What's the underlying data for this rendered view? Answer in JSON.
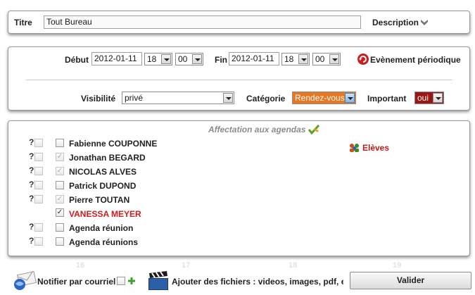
{
  "title_bar": {
    "label": "Titre",
    "value": "Tout Bureau",
    "description_label": "Description"
  },
  "dates": {
    "start_label": "Début",
    "start_date": "2012-01-11",
    "start_hour": "18",
    "start_minute": "00",
    "end_label": "Fin",
    "end_date": "2012-01-11",
    "end_hour": "18",
    "end_minute": "00",
    "recurring_label": "Evènement périodique"
  },
  "options": {
    "visibility_label": "Visibilité",
    "visibility_value": "privé",
    "category_label": "Catégorie",
    "category_value": "Rendez-vous",
    "category_color": "#e87722",
    "important_label": "Important",
    "important_value": "oui",
    "important_color": "#9a1616"
  },
  "agendas": {
    "heading": "Affectation aux agendas",
    "eleves_label": "Elèves",
    "items": [
      {
        "name": "Fabienne COUPONNE",
        "checked": false
      },
      {
        "name": "Jonathan BEGARD",
        "checked": true
      },
      {
        "name": "NICOLAS ALVES",
        "checked": true
      },
      {
        "name": "Patrick DUPOND",
        "checked": false
      },
      {
        "name": "Pierre TOUTAN",
        "checked": true
      },
      {
        "name": "VANESSA MEYER",
        "checked": true
      },
      {
        "name": "Agenda réunion",
        "checked": false
      },
      {
        "name": "Agenda réunions",
        "checked": false
      }
    ]
  },
  "background_calendar": {
    "days": [
      "16",
      "17",
      "18",
      "19"
    ]
  },
  "footer": {
    "notify_label": "Notifier par courriel",
    "files_label": "Ajouter des fichiers : videos, images, pdf, et",
    "submit_label": "Valider"
  }
}
